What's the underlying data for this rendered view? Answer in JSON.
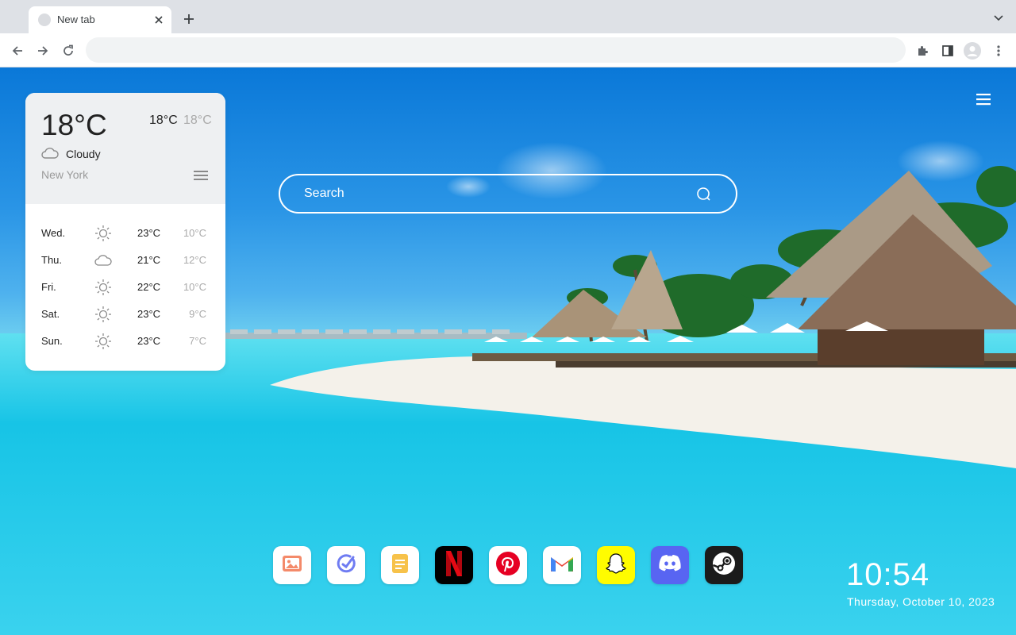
{
  "browser": {
    "tab_title": "New tab"
  },
  "weather": {
    "current_temp": "18°C",
    "high": "18°C",
    "low": "18°C",
    "condition": "Cloudy",
    "city": "New York",
    "forecast": [
      {
        "day": "Wed.",
        "icon": "sun-icon",
        "high": "23°C",
        "low": "10°C"
      },
      {
        "day": "Thu.",
        "icon": "cloud-icon",
        "high": "21°C",
        "low": "12°C"
      },
      {
        "day": "Fri.",
        "icon": "sun-icon",
        "high": "22°C",
        "low": "10°C"
      },
      {
        "day": "Sat.",
        "icon": "sun-icon",
        "high": "23°C",
        "low": "9°C"
      },
      {
        "day": "Sun.",
        "icon": "sun-icon",
        "high": "23°C",
        "low": "7°C"
      }
    ]
  },
  "search": {
    "placeholder": "Search"
  },
  "dock": [
    {
      "name": "gallery",
      "icon": "image-icon",
      "color": "#ffffff"
    },
    {
      "name": "tasks",
      "icon": "check-circle-icon",
      "color": "#ffffff"
    },
    {
      "name": "notes",
      "icon": "notes-icon",
      "color": "#ffffff"
    },
    {
      "name": "netflix",
      "icon": "netflix-icon",
      "color": "#000000"
    },
    {
      "name": "pinterest",
      "icon": "pinterest-icon",
      "color": "#ffffff"
    },
    {
      "name": "gmail",
      "icon": "gmail-icon",
      "color": "#ffffff"
    },
    {
      "name": "snapchat",
      "icon": "snapchat-icon",
      "color": "#fffc00"
    },
    {
      "name": "discord",
      "icon": "discord-icon",
      "color": "#5865f2"
    },
    {
      "name": "steam",
      "icon": "steam-icon",
      "color": "#1b1b1b"
    }
  ],
  "clock": {
    "time": "10:54",
    "date": "Thursday, October 10, 2023"
  }
}
